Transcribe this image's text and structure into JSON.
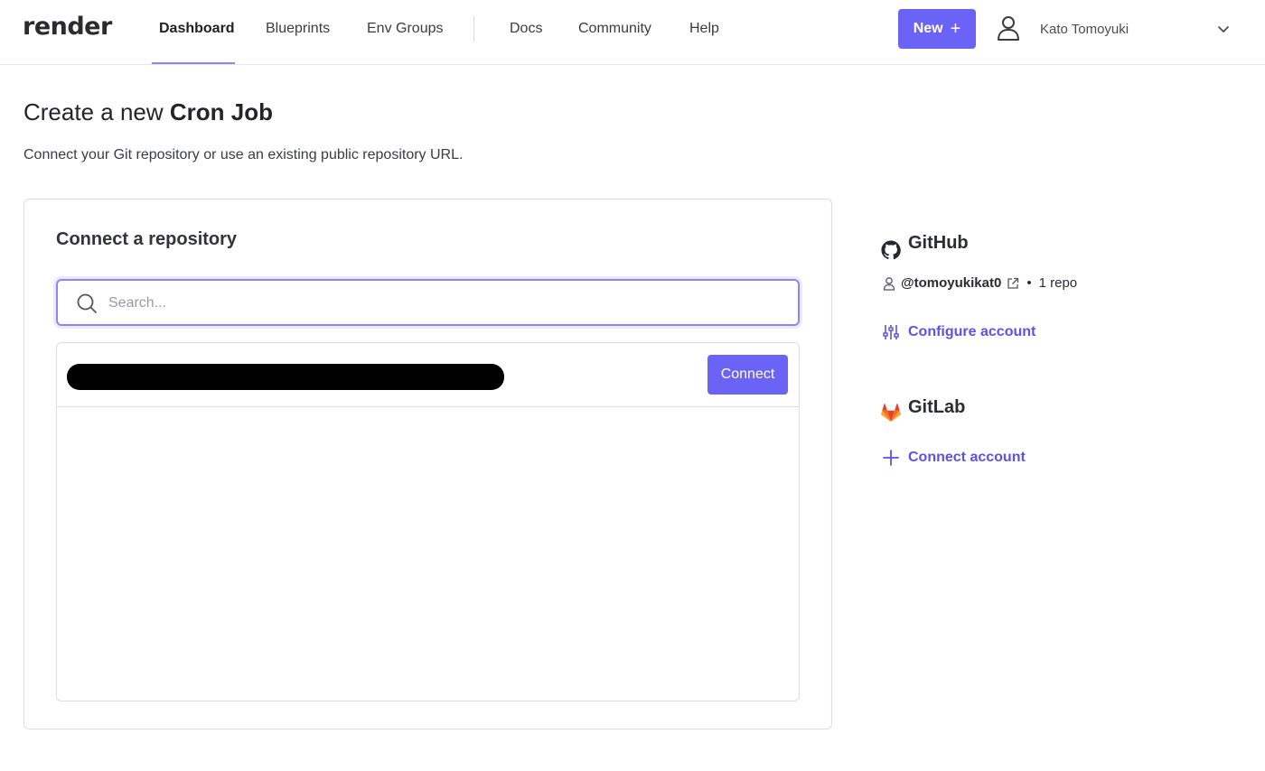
{
  "header": {
    "logo": "render",
    "nav": [
      "Dashboard",
      "Blueprints",
      "Env Groups",
      "Docs",
      "Community",
      "Help"
    ],
    "new_label": "New",
    "user_name": "Kato Tomoyuki"
  },
  "page": {
    "title_prefix": "Create a new",
    "title_strong": "Cron Job",
    "subtitle": "Connect your Git repository or use an existing public repository URL."
  },
  "repo_card": {
    "title": "Connect a repository",
    "search_placeholder": "Search...",
    "connect_label": "Connect"
  },
  "github": {
    "title": "GitHub",
    "handle": "@tomoyukikat0",
    "separator": "•",
    "repo_count": "1 repo",
    "configure_label": "Configure account"
  },
  "gitlab": {
    "title": "GitLab",
    "connect_label": "Connect account"
  },
  "colors": {
    "accent": "#6b63f6",
    "link": "#5b52e8",
    "border": "#dcdde6"
  }
}
